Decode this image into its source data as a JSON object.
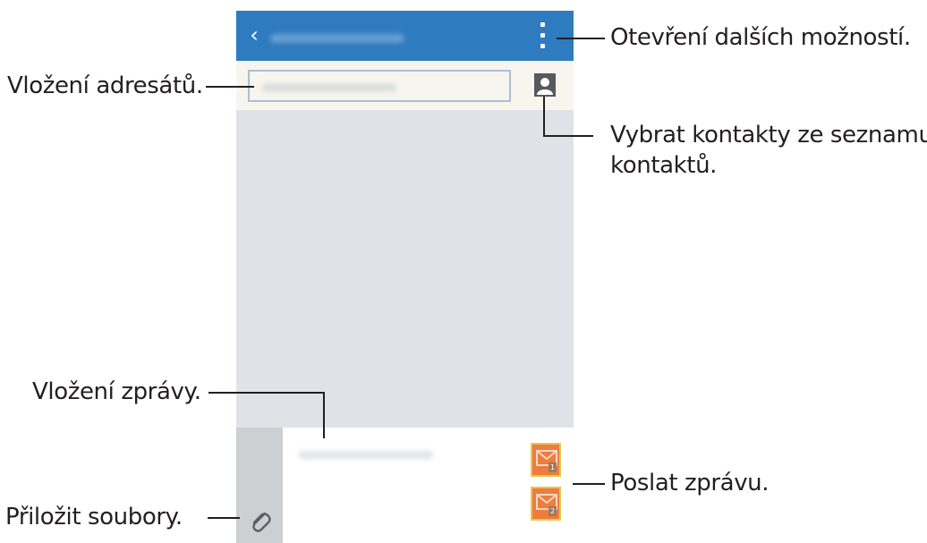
{
  "callouts": {
    "more_options": "Otevření dalších možností.",
    "enter_recipients": "Vložení adresátů.",
    "select_contacts_line1": "Vybrat kontakty ze seznamu",
    "select_contacts_line2": "kontaktů.",
    "enter_message": "Vložení zprávy.",
    "send_message": "Poslat zprávu.",
    "attach_files": "Přiložit soubory."
  },
  "send_buttons": [
    {
      "sim": "1"
    },
    {
      "sim": "2"
    }
  ],
  "icons": {
    "back": "chevron-left-icon",
    "menu": "more-vertical-icon",
    "contacts": "contact-person-icon",
    "attach": "paperclip-icon",
    "send": "envelope-icon"
  },
  "colors": {
    "app_bar": "#2f7bbf",
    "send_button": "#ee7c3e",
    "send_button_border": "#e5c84a",
    "background": "#dfe3e8"
  }
}
